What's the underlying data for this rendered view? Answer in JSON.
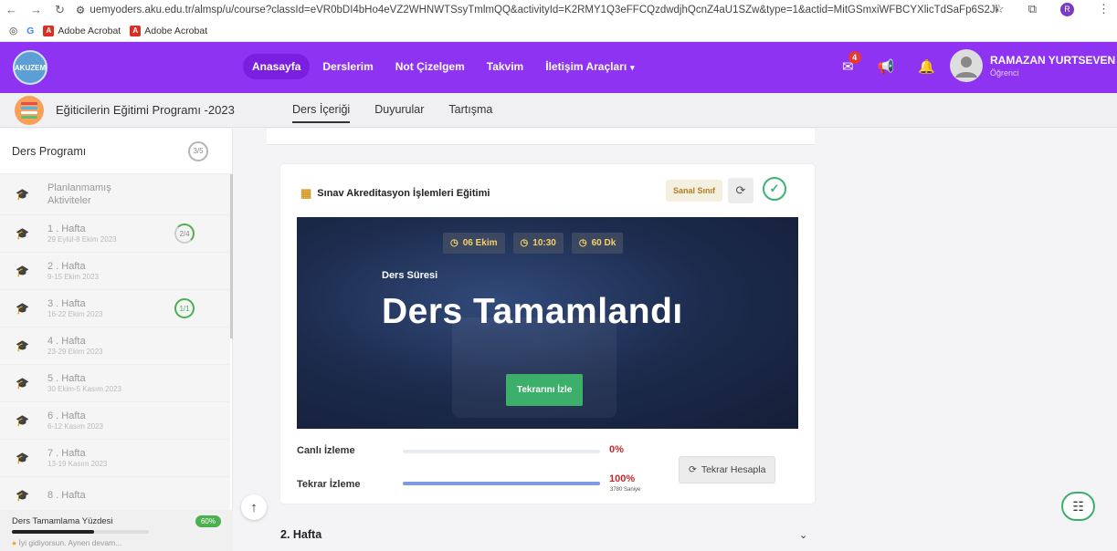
{
  "browser": {
    "url": "uemyoders.aku.edu.tr/almsp/u/course?classId=eVR0bDI4bHo4eVZ2WHNWTSsyTmlmQQ&activityId=K2RMY1Q3eFFCQzdwdjhQcnZ4aU1SZw&type=1&actid=MitGSmxiWFBCYXlicTdSaFp6S2Jkd...",
    "bookmarks": [
      "Adobe Acrobat",
      "Adobe Acrobat"
    ],
    "profile_initial": "R"
  },
  "header": {
    "logo_text": "AKUZEM",
    "nav": [
      "Anasayfa",
      "Derslerim",
      "Not Çizelgem",
      "Takvim",
      "İletişim Araçları"
    ],
    "notif_count": "4",
    "user_name": "RAMAZAN YURTSEVEN",
    "user_role": "Öğrenci"
  },
  "course": {
    "title": "Eğiticilerin Eğitimi Programı -2023",
    "tabs": [
      "Ders İçeriği",
      "Duyurular",
      "Tartışma"
    ]
  },
  "sidebar": {
    "heading": "Ders Programı",
    "heading_count": "3/5",
    "items": [
      {
        "title": "Planlanmamış Aktiviteler",
        "sub": "",
        "count": ""
      },
      {
        "title": "1 . Hafta",
        "sub": "29 Eylül-8 Ekim 2023",
        "count": "2/4"
      },
      {
        "title": "2 . Hafta",
        "sub": "9-15 Ekim 2023",
        "count": ""
      },
      {
        "title": "3 . Hafta",
        "sub": "16-22 Ekim 2023",
        "count": "1/1"
      },
      {
        "title": "4 . Hafta",
        "sub": "23-29 Ekim 2023",
        "count": ""
      },
      {
        "title": "5 . Hafta",
        "sub": "30 Ekim-5 Kasım 2023",
        "count": ""
      },
      {
        "title": "6 . Hafta",
        "sub": "6-12 Kasım 2023",
        "count": ""
      },
      {
        "title": "7 . Hafta",
        "sub": "13-19 Kasım 2023",
        "count": ""
      },
      {
        "title": "8 . Hafta",
        "sub": "",
        "count": ""
      }
    ],
    "completion_label": "Ders Tamamlama Yüzdesi",
    "completion_pct": "60%",
    "completion_fraction": 0.6,
    "message": "İyi gidiyorsun. Aynen devam..."
  },
  "activity": {
    "title": "Sınav Akreditasyon İşlemleri Eğitimi",
    "type_badge": "Sanal Sınıf",
    "date": "06 Ekim",
    "time": "10:30",
    "duration": "60 Dk",
    "duration_label": "Ders Süresi",
    "status": "Ders Tamamlandı",
    "replay_button": "Tekrarını İzle",
    "live_label": "Canlı İzleme",
    "live_pct": "0%",
    "live_fraction": 0,
    "replay_label": "Tekrar İzleme",
    "replay_pct": "100%",
    "replay_fraction": 1,
    "replay_seconds": "3780 Saniye",
    "recalc_button": "Tekrar Hesapla"
  },
  "next_section": "2. Hafta"
}
